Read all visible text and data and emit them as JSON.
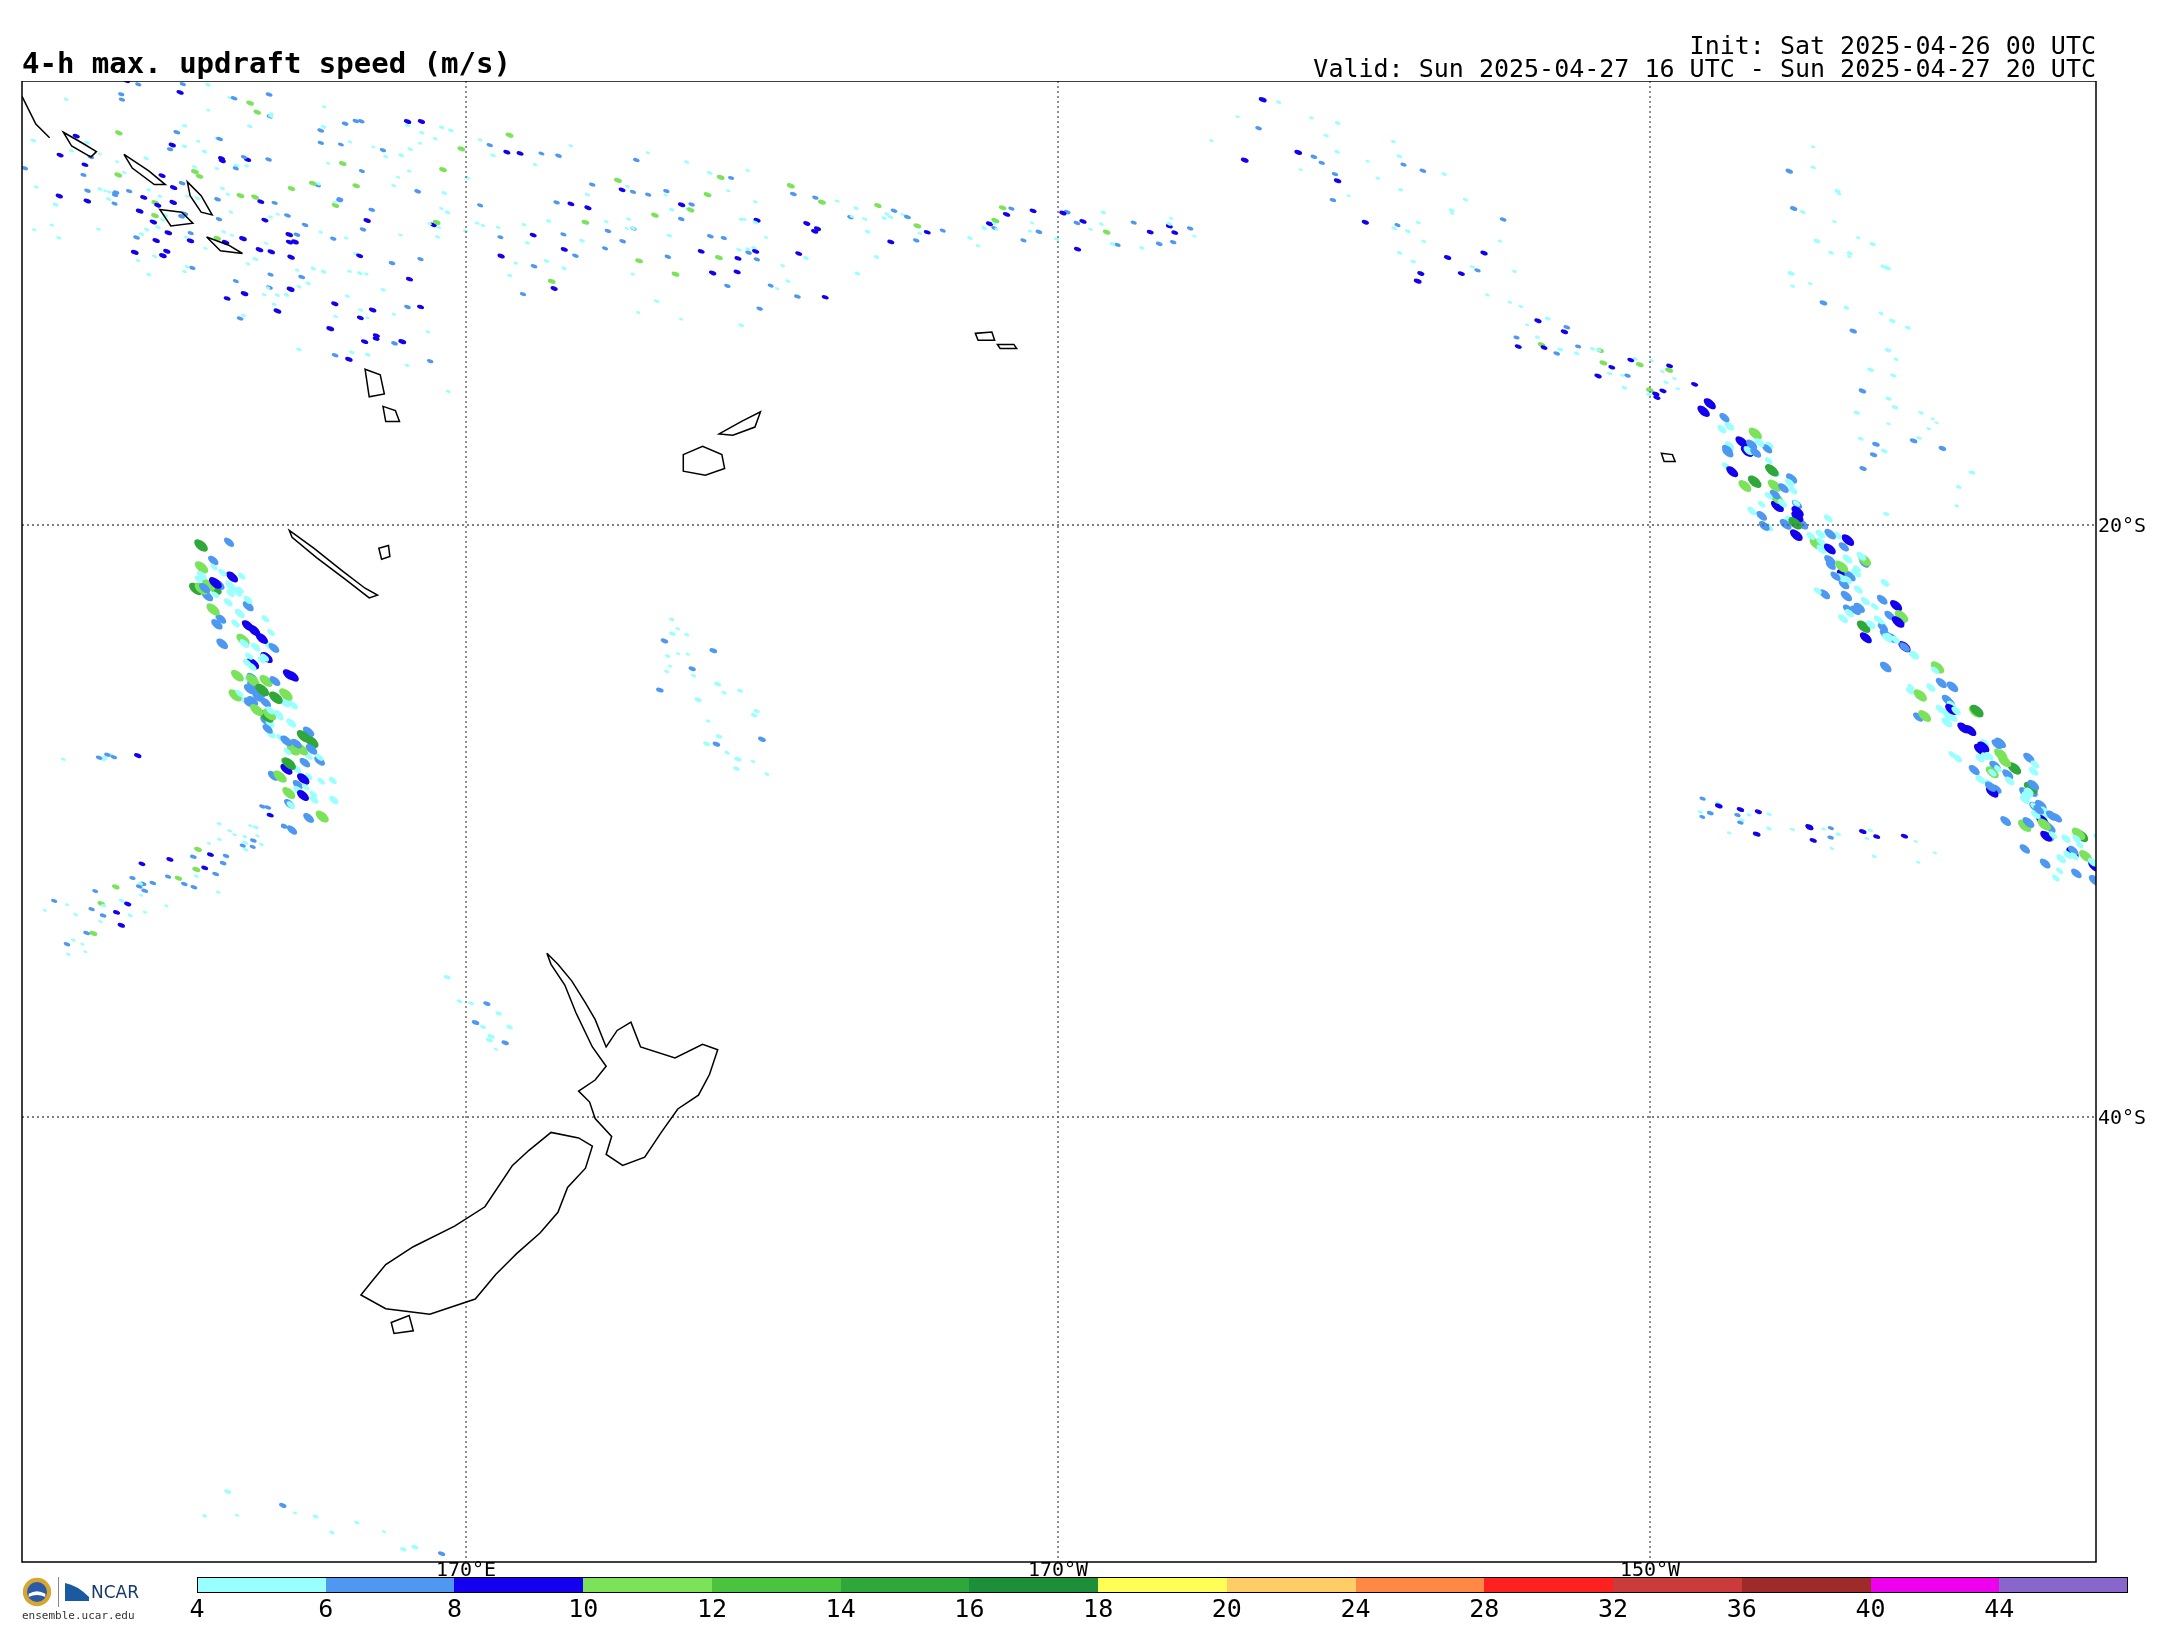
{
  "title": "4-h max. updraft speed (m/s)",
  "init": "Init: Sat 2025-04-26 00 UTC",
  "valid": "Valid: Sun 2025-04-27 16 UTC - Sun 2025-04-27 20 UTC",
  "map": {
    "latitude_labels": [
      "20°S",
      "40°S"
    ],
    "longitude_labels": [
      "170°E",
      "170°W",
      "150°W"
    ]
  },
  "logos": {
    "wordmark": "NCAR",
    "website": "ensemble.ucar.edu"
  },
  "colorbar": [
    {
      "label": "4",
      "color": "#99ffff"
    },
    {
      "label": "6",
      "color": "#4f98f2"
    },
    {
      "label": "8",
      "color": "#1200ee"
    },
    {
      "label": "10",
      "color": "#7be35a"
    },
    {
      "label": "12",
      "color": "#4ac43e"
    },
    {
      "label": "14",
      "color": "#2fa73a"
    },
    {
      "label": "16",
      "color": "#1d8f3b"
    },
    {
      "label": "18",
      "color": "#ffff55"
    },
    {
      "label": "20",
      "color": "#ffcc66"
    },
    {
      "label": "24",
      "color": "#ff8844"
    },
    {
      "label": "28",
      "color": "#ff2020"
    },
    {
      "label": "32",
      "color": "#cc3b3b"
    },
    {
      "label": "36",
      "color": "#9e2a2a"
    },
    {
      "label": "40",
      "color": "#ee00ee"
    },
    {
      "label": "44",
      "color": "#8866cc"
    }
  ]
}
